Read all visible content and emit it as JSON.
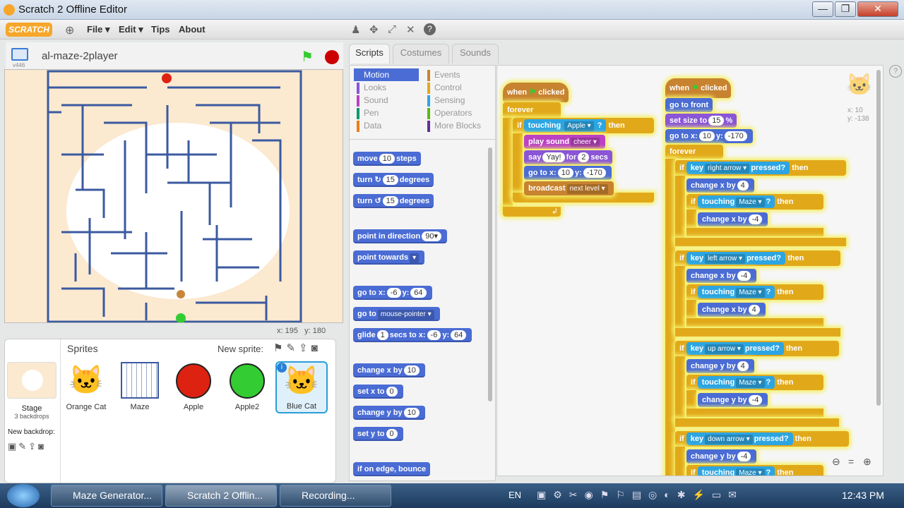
{
  "window": {
    "title": "Scratch 2 Offline Editor"
  },
  "menu": {
    "logo": "SCRATCH",
    "items": [
      "File ▾",
      "Edit ▾",
      "Tips",
      "About"
    ]
  },
  "stage_header": {
    "project_name": "al-maze-2player",
    "version": "v446"
  },
  "stage": {
    "coords": "x: 195   y: 180"
  },
  "tabs": [
    "Scripts",
    "Costumes",
    "Sounds"
  ],
  "categories_left": [
    "Motion",
    "Looks",
    "Sound",
    "Pen",
    "Data"
  ],
  "categories_right": [
    "Events",
    "Control",
    "Sensing",
    "Operators",
    "More Blocks"
  ],
  "palette": {
    "move": "move",
    "move_n": "10",
    "move_unit": "steps",
    "turn": "turn",
    "turn_n": "15",
    "degrees": "degrees",
    "point_dir": "point in direction",
    "point_dir_n": "90▾",
    "point_towards": "point towards",
    "goto_xy": "go to x:",
    "gx": "-6",
    "y": "y:",
    "gy": "64",
    "goto": "go to",
    "goto_target": "mouse-pointer ▾",
    "glide": "glide",
    "glide_n": "1",
    "glide_mid": "secs to x:",
    "glx": "-6",
    "gly": "64",
    "change_x": "change x by",
    "cx": "10",
    "set_x": "set x to",
    "sx": "0",
    "change_y": "change y by",
    "cy": "10",
    "set_y": "set y to",
    "sy": "0",
    "edge": "if on edge, bounce"
  },
  "script1": {
    "when": "when",
    "clicked": "clicked",
    "forever": "forever",
    "if": "if",
    "touching": "touching",
    "apple": "Apple ▾",
    "q": "?",
    "then": "then",
    "play": "play sound",
    "cheer": "cheer ▾",
    "say": "say",
    "yay": "Yay!",
    "for": "for",
    "two": "2",
    "secs": "secs",
    "goto": "go to x:",
    "x10": "10",
    "y": "y:",
    "ym": "-170",
    "broadcast": "broadcast",
    "next": "next level ▾"
  },
  "script2": {
    "when": "when",
    "clicked": "clicked",
    "front": "go to front",
    "setsize": "set size to",
    "size": "15",
    "pct": "%",
    "goto": "go to x:",
    "x10": "10",
    "y": "y:",
    "ym": "-170",
    "forever": "forever",
    "if": "if",
    "key": "key",
    "pressed": "pressed?",
    "then": "then",
    "right": "right arrow ▾",
    "left": "left arrow ▾",
    "up": "up arrow ▾",
    "down": "down arrow ▾",
    "cx": "change x by",
    "cy": "change y by",
    "touching": "touching",
    "maze": "Maze ▾",
    "q": "?",
    "p4": "4",
    "m4": "-4"
  },
  "sprite_info": {
    "x": "x: 10",
    "y": "y: -138"
  },
  "sprites": {
    "title": "Sprites",
    "new_sprite": "New sprite:",
    "stage_label": "Stage",
    "backdrops": "3 backdrops",
    "new_backdrop": "New backdrop:",
    "items": [
      "Orange Cat",
      "Maze",
      "Apple",
      "Apple2",
      "Blue Cat"
    ]
  },
  "taskbar": {
    "items": [
      "Maze Generator...",
      "Scratch 2 Offlin...",
      "Recording..."
    ],
    "lang": "EN",
    "time": "12:43 PM"
  }
}
